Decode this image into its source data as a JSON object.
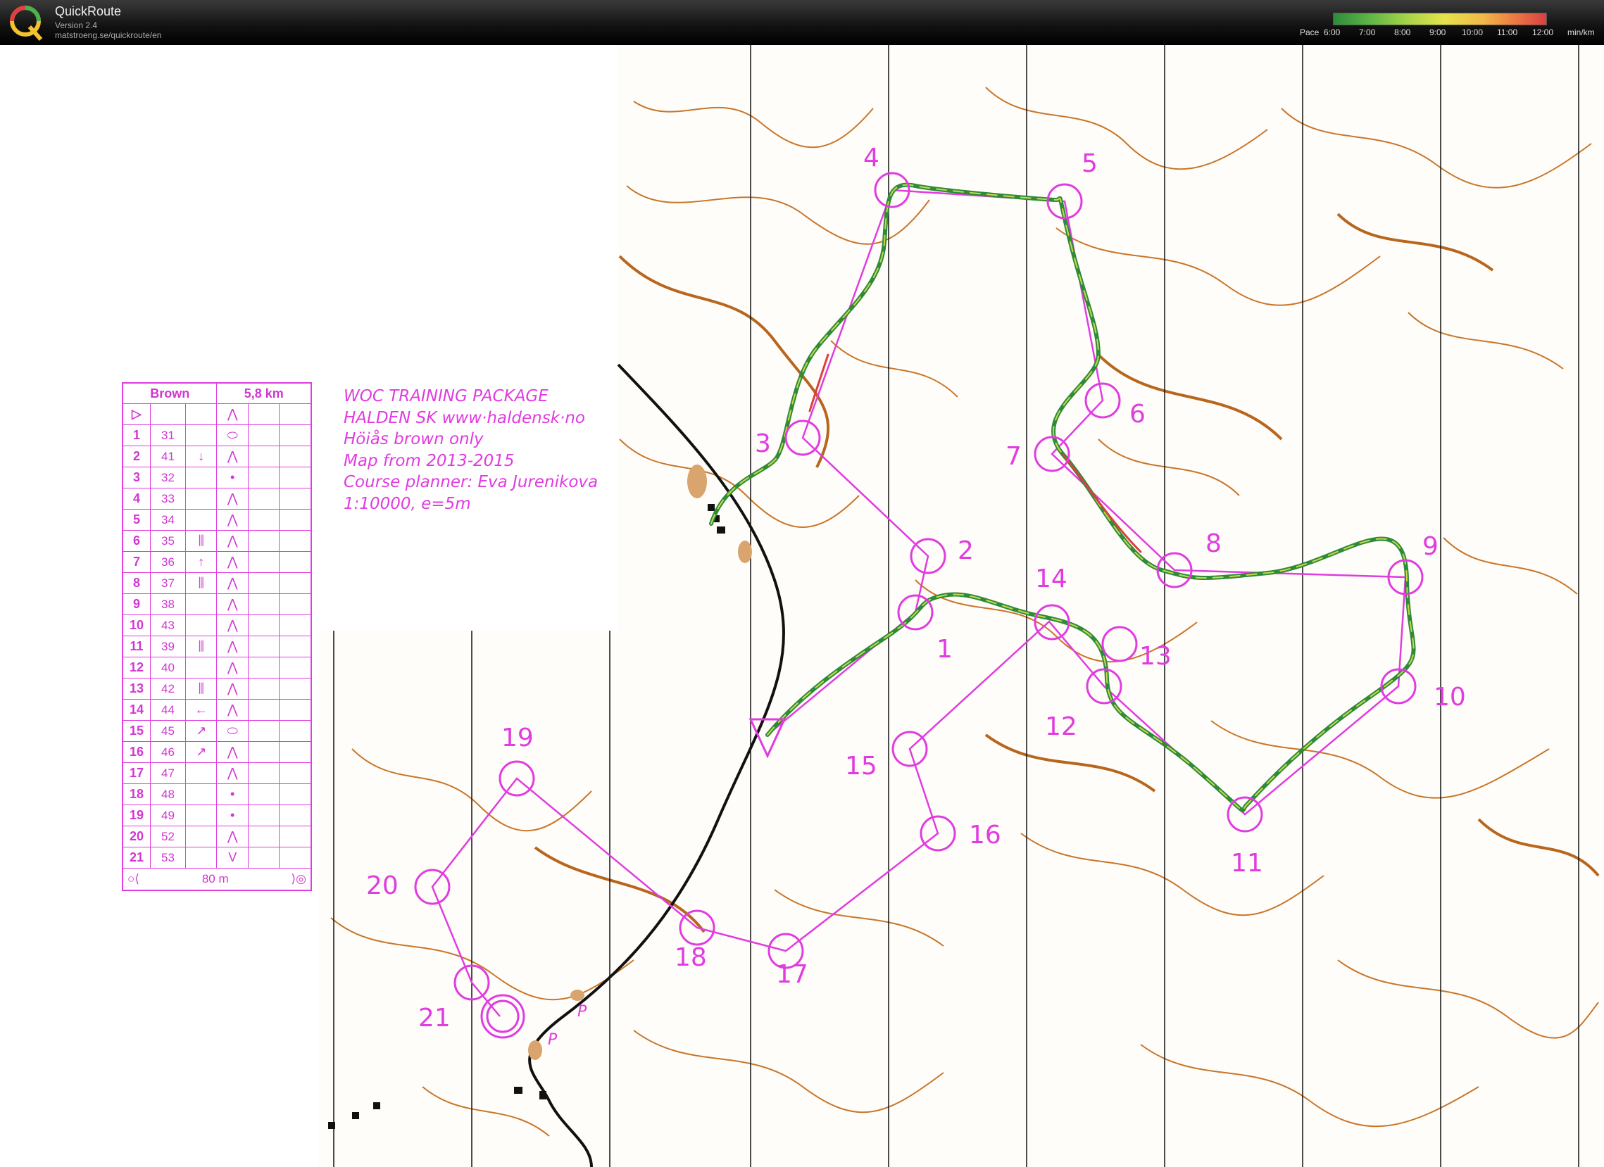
{
  "app": {
    "title": "QuickRoute",
    "version": "Version 2.4",
    "url": "matstroeng.se/quickroute/en"
  },
  "pace_scale": {
    "label": "Pace",
    "ticks": [
      "6:00",
      "7:00",
      "8:00",
      "9:00",
      "10:00",
      "11:00",
      "12:00"
    ],
    "unit": "min/km"
  },
  "info_lines": [
    "WOC TRAINING PACKAGE",
    "HALDEN SK www·haldensk·no",
    "Höiås brown only",
    "Map from 2013-2015",
    "Course planner: Eva Jurenikova",
    "1:10000, e=5m"
  ],
  "legend": {
    "course": "Brown",
    "length": "5,8 km",
    "start_symbol": "▷",
    "start_feature": "⋀",
    "rows": [
      {
        "no": "1",
        "code": "31",
        "dir": "",
        "feature": "⬭"
      },
      {
        "no": "2",
        "code": "41",
        "dir": "↓",
        "feature": "⋀"
      },
      {
        "no": "3",
        "code": "32",
        "dir": "",
        "feature": "•"
      },
      {
        "no": "4",
        "code": "33",
        "dir": "",
        "feature": "⋀"
      },
      {
        "no": "5",
        "code": "34",
        "dir": "",
        "feature": "⋀"
      },
      {
        "no": "6",
        "code": "35",
        "dir": "⫼",
        "feature": "⋀"
      },
      {
        "no": "7",
        "code": "36",
        "dir": "↑",
        "feature": "⋀"
      },
      {
        "no": "8",
        "code": "37",
        "dir": "⫼",
        "feature": "⋀"
      },
      {
        "no": "9",
        "code": "38",
        "dir": "",
        "feature": "⋀"
      },
      {
        "no": "10",
        "code": "43",
        "dir": "",
        "feature": "⋀"
      },
      {
        "no": "11",
        "code": "39",
        "dir": "⫼",
        "feature": "⋀"
      },
      {
        "no": "12",
        "code": "40",
        "dir": "",
        "feature": "⋀"
      },
      {
        "no": "13",
        "code": "42",
        "dir": "⫼",
        "feature": "⋀"
      },
      {
        "no": "14",
        "code": "44",
        "dir": "←",
        "feature": "⋀"
      },
      {
        "no": "15",
        "code": "45",
        "dir": "↗",
        "feature": "⬭"
      },
      {
        "no": "16",
        "code": "46",
        "dir": "↗",
        "feature": "⋀"
      },
      {
        "no": "17",
        "code": "47",
        "dir": "",
        "feature": "⋀"
      },
      {
        "no": "18",
        "code": "48",
        "dir": "",
        "feature": "•"
      },
      {
        "no": "19",
        "code": "49",
        "dir": "",
        "feature": "•"
      },
      {
        "no": "20",
        "code": "52",
        "dir": "",
        "feature": "⋀"
      },
      {
        "no": "21",
        "code": "53",
        "dir": "",
        "feature": "V"
      }
    ],
    "finish_distance": "80 m"
  },
  "controls": [
    "1",
    "2",
    "3",
    "4",
    "5",
    "6",
    "7",
    "8",
    "9",
    "10",
    "11",
    "12",
    "13",
    "14",
    "15",
    "16",
    "17",
    "18",
    "19",
    "20",
    "21"
  ],
  "map_labels": [
    "P",
    "P"
  ],
  "colors": {
    "course": "#e03ce0",
    "contour": "#c8762a",
    "route_fast": "#2e8b3a",
    "route_slow": "#d94040",
    "road": "#111111"
  }
}
